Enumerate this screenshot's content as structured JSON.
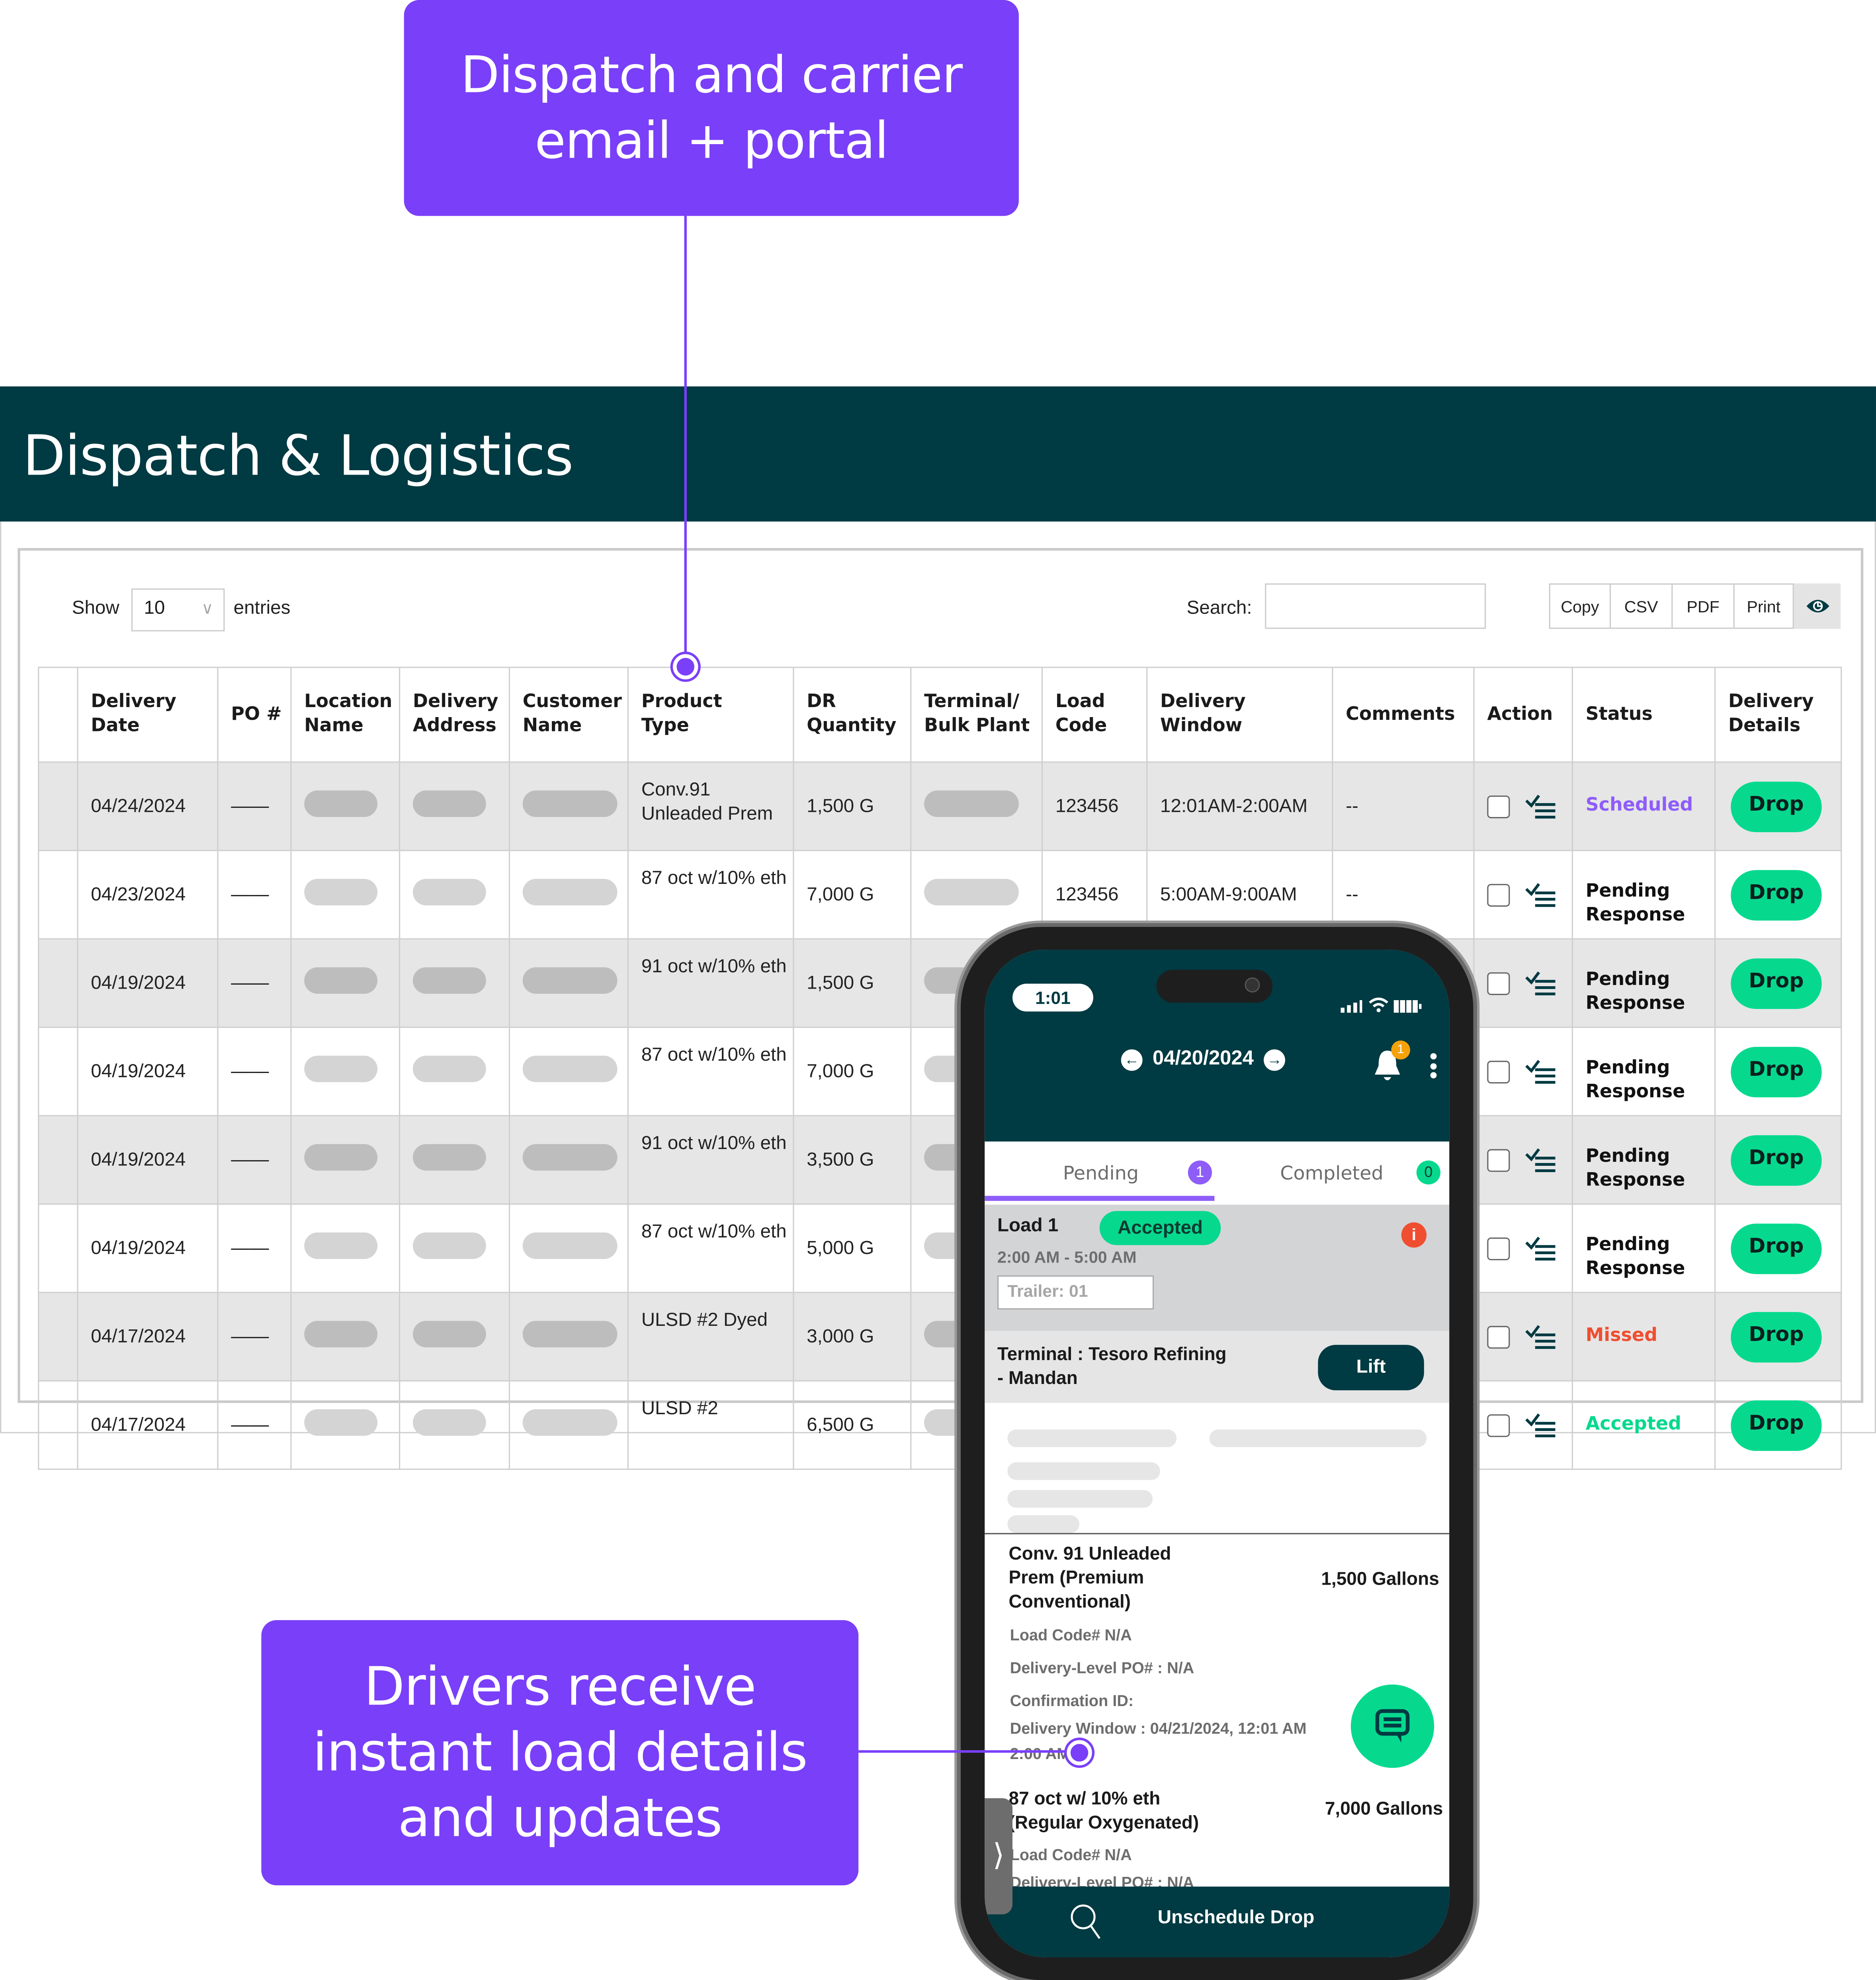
{
  "callouts": {
    "top": "Dispatch and carrier\nemail + portal",
    "bottom": "Drivers receive\ninstant load details\nand updates"
  },
  "colors": {
    "brand_dark": "#003a42",
    "callout_purple": "#7a3ff8",
    "accent_green": "#06d98e",
    "status_scheduled": "#8e5df8",
    "status_missed": "#f04e30",
    "status_accepted": "#06d98e",
    "status_pending": "#111111"
  },
  "app": {
    "title": "Dispatch & Logistics"
  },
  "table_controls": {
    "show_label": "Show",
    "entries_value": "10",
    "entries_label": "entries",
    "search_label": "Search:",
    "search_value": "",
    "export_buttons": [
      "Copy",
      "CSV",
      "PDF",
      "Print"
    ],
    "visibility_icon": "eye-icon"
  },
  "table": {
    "columns": [
      "",
      "Delivery\nDate",
      "PO #",
      "Location\nName",
      "Delivery\nAddress",
      "Customer\nName",
      "Product\nType",
      "DR\nQuantity",
      "Terminal/\nBulk Plant",
      "Load\nCode",
      "Delivery\nWindow",
      "Comments",
      "Action",
      "Status",
      "Delivery\nDetails"
    ],
    "rows": [
      {
        "delivery_date": "04/24/2024",
        "po": "——",
        "product_type": "Conv.91\nUnleaded Prem",
        "dr_quantity": "1,500 G",
        "load_code": "123456",
        "delivery_window": "12:01AM-2:00AM",
        "comments": "--",
        "status": "Scheduled",
        "status_kind": "scheduled",
        "details_button": "Drop"
      },
      {
        "delivery_date": "04/23/2024",
        "po": "——",
        "product_type": "87 oct w/10% eth",
        "dr_quantity": "7,000 G",
        "load_code": "123456",
        "delivery_window": "5:00AM-9:00AM",
        "comments": "--",
        "status": "Pending\nResponse",
        "status_kind": "pending",
        "details_button": "Drop"
      },
      {
        "delivery_date": "04/19/2024",
        "po": "——",
        "product_type": "91 oct w/10% eth",
        "dr_quantity": "1,500 G",
        "load_code": "",
        "delivery_window": "",
        "comments": "",
        "status": "Pending\nResponse",
        "status_kind": "pending",
        "details_button": "Drop"
      },
      {
        "delivery_date": "04/19/2024",
        "po": "——",
        "product_type": "87 oct w/10% eth",
        "dr_quantity": "7,000 G",
        "load_code": "",
        "delivery_window": "",
        "comments": "",
        "status": "Pending\nResponse",
        "status_kind": "pending",
        "details_button": "Drop"
      },
      {
        "delivery_date": "04/19/2024",
        "po": "——",
        "product_type": "91 oct w/10% eth",
        "dr_quantity": "3,500 G",
        "load_code": "",
        "delivery_window": "",
        "comments": "",
        "status": "Pending\nResponse",
        "status_kind": "pending",
        "details_button": "Drop"
      },
      {
        "delivery_date": "04/19/2024",
        "po": "——",
        "product_type": "87 oct w/10% eth",
        "dr_quantity": "5,000 G",
        "load_code": "",
        "delivery_window": "",
        "comments": "",
        "status": "Pending\nResponse",
        "status_kind": "pending",
        "details_button": "Drop"
      },
      {
        "delivery_date": "04/17/2024",
        "po": "——",
        "product_type": "ULSD #2 Dyed",
        "dr_quantity": "3,000 G",
        "load_code": "",
        "delivery_window": "",
        "comments": "",
        "status": "Missed",
        "status_kind": "missed",
        "details_button": "Drop"
      },
      {
        "delivery_date": "04/17/2024",
        "po": "——",
        "product_type": "ULSD #2",
        "dr_quantity": "6,500 G",
        "load_code": "",
        "delivery_window": "",
        "comments": "",
        "status": "Accepted",
        "status_kind": "accepted",
        "details_button": "Drop"
      }
    ]
  },
  "phone": {
    "status_time": "1:01",
    "date": "04/20/2024",
    "notification_count": "1",
    "tabs": [
      {
        "label": "Pending",
        "count": "1",
        "active": true
      },
      {
        "label": "Completed",
        "count": "0",
        "active": false
      }
    ],
    "load": {
      "title": "Load 1",
      "status": "Accepted",
      "time_window": "2:00 AM - 5:00 AM",
      "trailer_placeholder": "Trailer: 01",
      "terminal": "Terminal : Tesoro Refining\n-   Mandan",
      "lift_button": "Lift"
    },
    "products": [
      {
        "name": "Conv. 91 Unleaded\nPrem (Premium\nConventional)",
        "quantity": "1,500 Gallons",
        "load_code": "Load Code# N/A",
        "po": "Delivery-Level PO# : N/A",
        "confirmation": "Confirmation ID:",
        "delivery_window": "Delivery Window : 04/21/2024, 12:01 AM",
        "delivery_window_end": "2:00 AM"
      },
      {
        "name": "87 oct w/ 10% eth\n(Regular Oxygenated)",
        "quantity": "7,000 Gallons",
        "load_code": "Load Code# N/A",
        "po": "Delivery-Level PO# : N/A"
      }
    ],
    "bottom_action": "Unschedule Drop"
  }
}
